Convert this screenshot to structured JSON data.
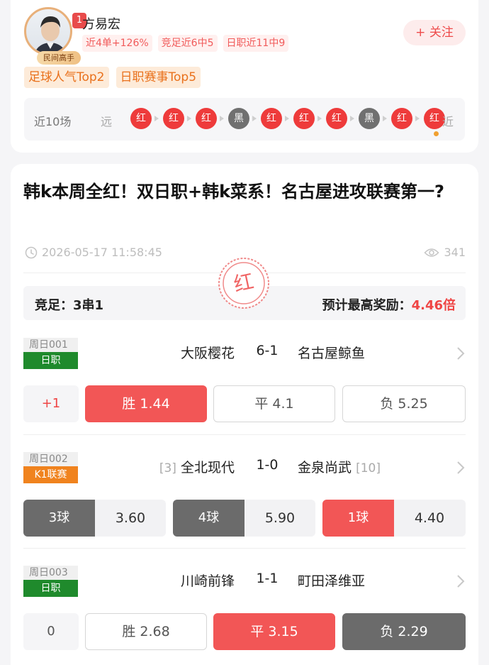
{
  "author": {
    "name": "方易宏",
    "rank_badge": "1",
    "level_badge": "民间高手",
    "follow_label": "+ 关注",
    "stat_tags": [
      "近4单+126%",
      "竞足近6中5",
      "日职近11中9"
    ],
    "honor_tags": [
      "足球人气Top2",
      "日职赛事Top5"
    ],
    "recent": {
      "label": "近10场",
      "far_label": "远",
      "near_label": "近",
      "results": [
        "红",
        "红",
        "红",
        "黑",
        "红",
        "红",
        "红",
        "黑",
        "红",
        "红"
      ]
    }
  },
  "post": {
    "title": "韩k本周全红！双日职+韩k菜系！名古屋进攻联赛第一?",
    "time": "2026-05-17 11:58:45",
    "views": "341",
    "stamp": "红",
    "summary": {
      "play_label": "竞足：",
      "play_value": "3串1",
      "reward_label": "预计最高奖励：",
      "reward_value": "4.46倍"
    },
    "matches": [
      {
        "number": "周日001",
        "league": "日职",
        "home": "大阪樱花",
        "score": "6-1",
        "away": "名古屋鲸鱼",
        "handicap": "+1",
        "options": [
          {
            "label": "胜 1.44",
            "selected": true
          },
          {
            "label": "平 4.1",
            "selected": false
          },
          {
            "label": "负 5.25",
            "selected": false
          }
        ]
      },
      {
        "number": "周日002",
        "league": "K1联赛",
        "home_rank": "[3]",
        "home": "全北现代",
        "score": "1-0",
        "away": "金泉尚武",
        "away_rank": "[10]",
        "goal_options": [
          {
            "label": "3球",
            "odds": "3.60",
            "selected": false
          },
          {
            "label": "4球",
            "odds": "5.90",
            "selected": false
          },
          {
            "label": "1球",
            "odds": "4.40",
            "selected": true
          }
        ]
      },
      {
        "number": "周日003",
        "league": "日职",
        "home": "川崎前锋",
        "score": "1-1",
        "away": "町田泽维亚",
        "handicap": "0",
        "options": [
          {
            "label": "胜 2.68",
            "selected": false
          },
          {
            "label": "平 3.15",
            "selected": true
          },
          {
            "label": "负 2.29",
            "selected": false
          }
        ]
      }
    ]
  },
  "colors": {
    "red": "#ee3b3b",
    "black_result": "#707070",
    "accent_orange": "#e9711c",
    "league_green": "#1f8a2c",
    "league_orange": "#f0831e"
  },
  "icons": [
    "clock-icon",
    "eye-icon",
    "chevron-right-icon",
    "follow-plus-icon"
  ]
}
